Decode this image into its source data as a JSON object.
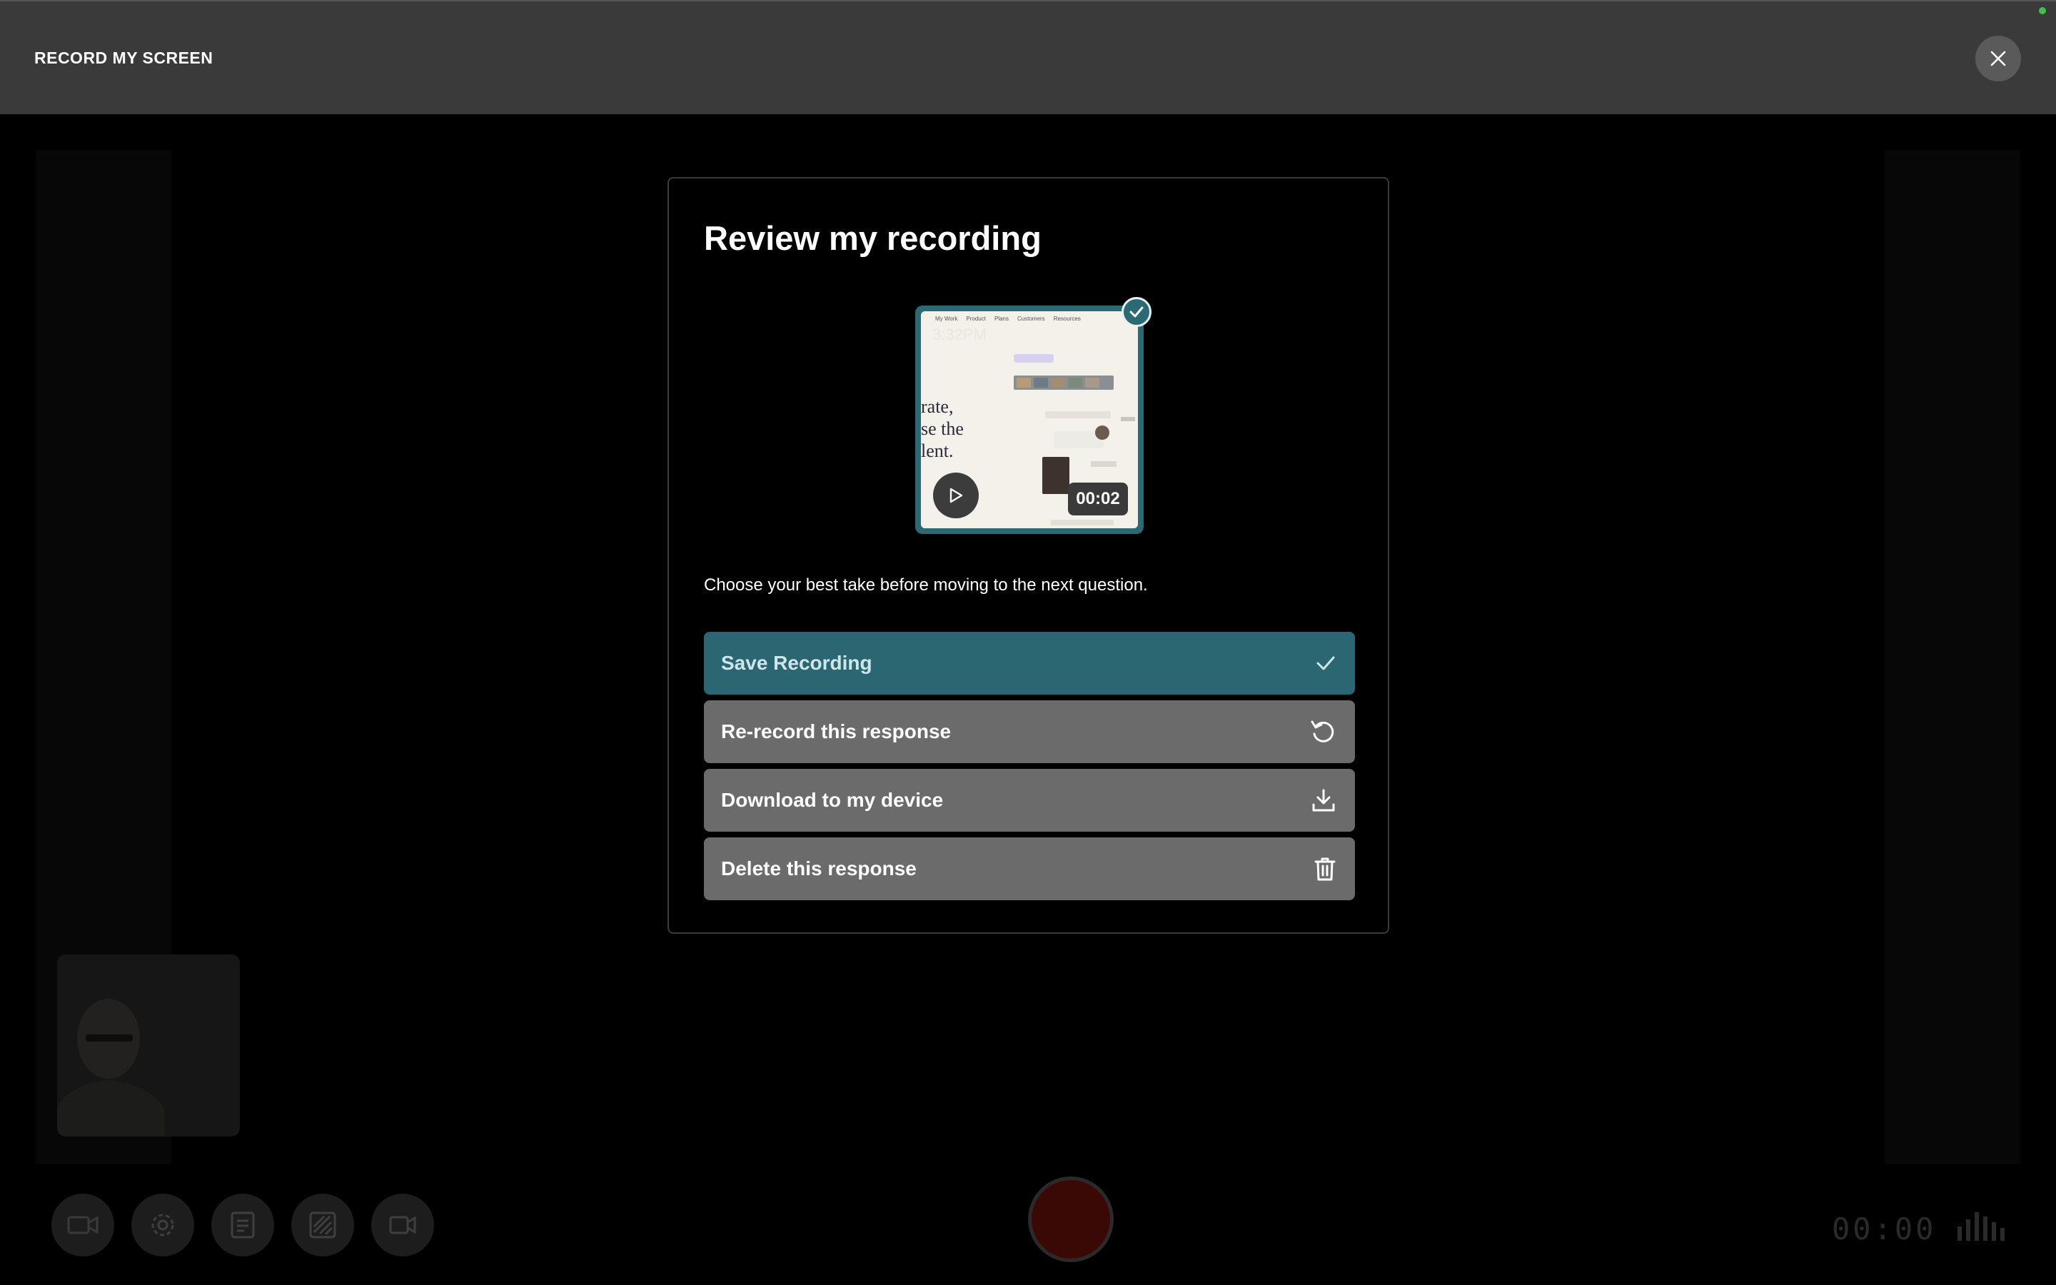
{
  "header": {
    "title": "RECORD MY SCREEN"
  },
  "modal": {
    "heading": "Review my recording",
    "preview": {
      "duration": "00:02",
      "thumb_time": "3:32PM",
      "thumb_nav": [
        "My Work",
        "Product",
        "Plans",
        "Customers",
        "Resources"
      ],
      "thumb_text": [
        "rate,",
        "se the",
        "lent."
      ]
    },
    "subtitle": "Choose your best take before moving to the next question.",
    "actions": [
      {
        "label": "Save Recording",
        "icon": "checkmark-icon"
      },
      {
        "label": "Re-record this response",
        "icon": "rerecord-icon"
      },
      {
        "label": "Download to my device",
        "icon": "download-icon"
      },
      {
        "label": "Delete this response",
        "icon": "trash-icon"
      }
    ]
  },
  "toolbar": {
    "buttons": [
      "camera-icon",
      "settings-icon",
      "script-icon",
      "background-icon",
      "camera-switch-icon"
    ],
    "timer": "00:00"
  },
  "colors": {
    "accent": "#2a6773",
    "topbar": "#3a3a3a",
    "secondary_button": "#6b6b6b",
    "status_dot": "#3ec24a"
  }
}
